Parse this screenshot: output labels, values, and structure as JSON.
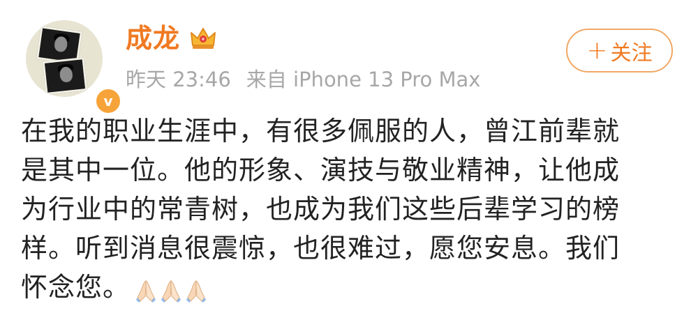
{
  "user": {
    "name": "成龙",
    "badge_letter": "v",
    "crown_icon": "crown-icon",
    "time": "昨天 23:46",
    "source": "来自 iPhone 13 Pro Max"
  },
  "follow_button": {
    "plus": "+",
    "label": "关注"
  },
  "post": {
    "lines": [
      "在我的职业生涯中，有很多佩服的人，曾江前辈就",
      "是其中一位。他的形象、演技与敬业精神，让他成",
      "为行业中的常青树，也成为我们这些后辈学习的榜",
      "样。听到消息很震惊，也很难过，愿您安息。我们",
      "怀念您。"
    ],
    "emoji": [
      "folded-hands-icon",
      "folded-hands-icon",
      "folded-hands-icon"
    ]
  },
  "colors": {
    "accent": "#f07a22",
    "meta": "#a7a7a7",
    "text": "#222222",
    "badge": "#f6a43a"
  }
}
